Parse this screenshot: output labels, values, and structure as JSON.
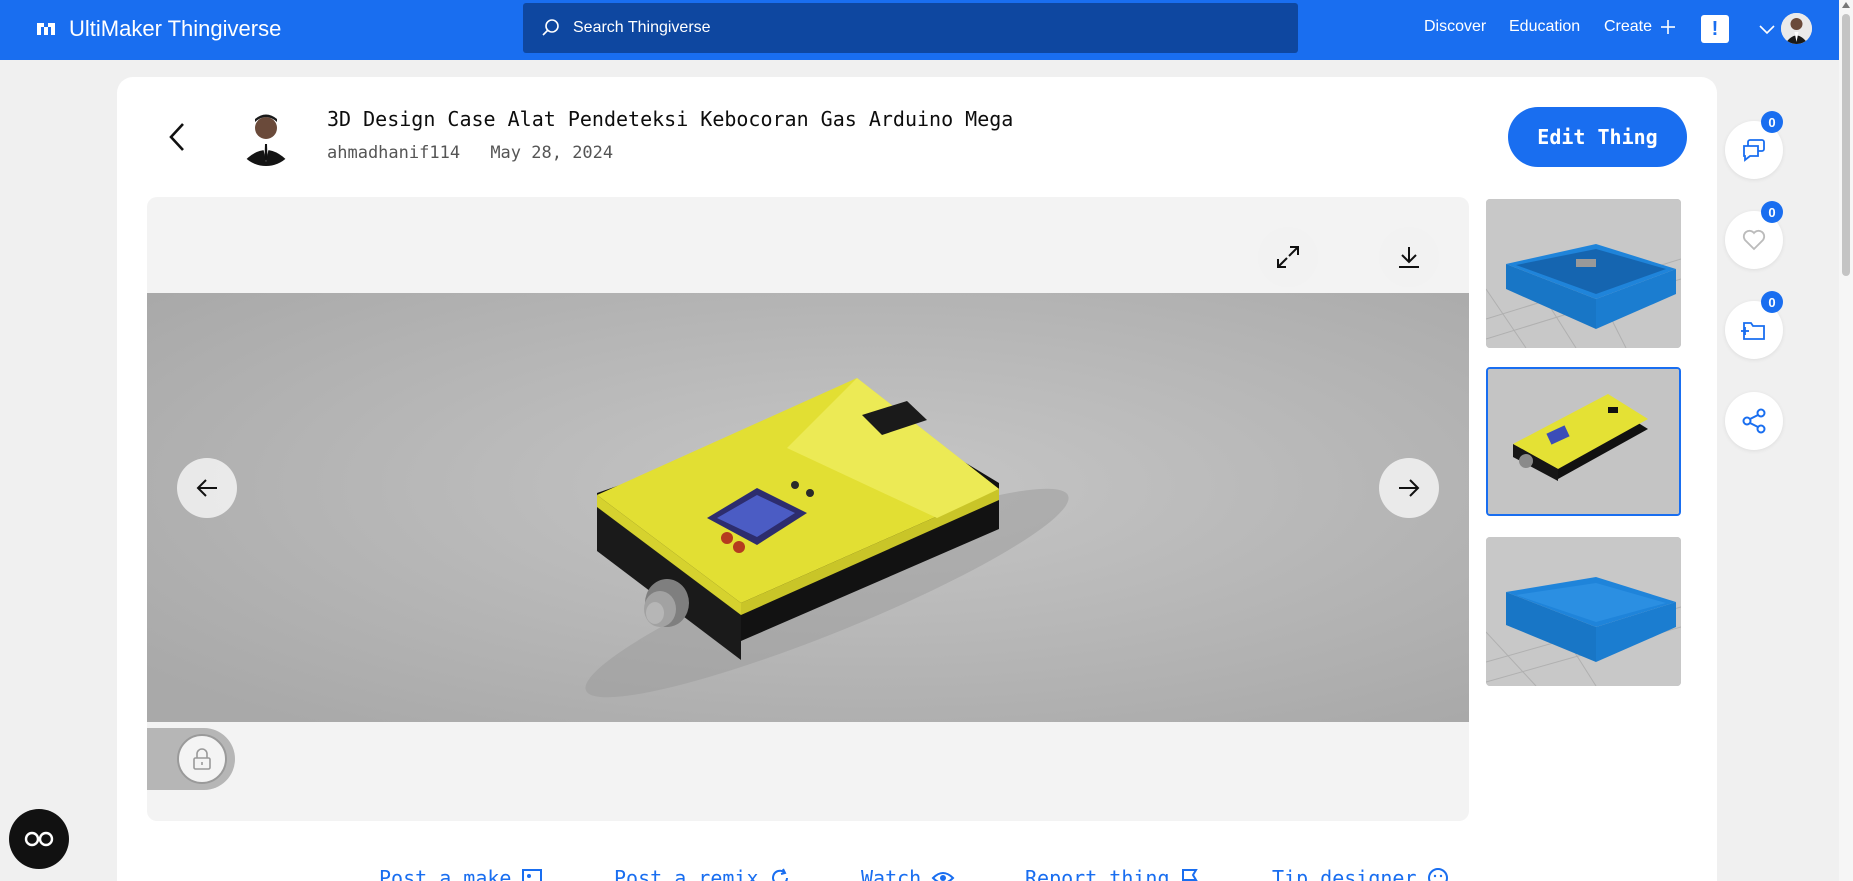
{
  "nav": {
    "brand": "UltiMaker Thingiverse",
    "search_placeholder": "Search Thingiverse",
    "links": [
      "Discover",
      "Education",
      "Create"
    ],
    "alert": "!"
  },
  "thing": {
    "title": "3D Design Case Alat Pendeteksi Kebocoran Gas Arduino Mega",
    "author": "ahmadhanif114",
    "date": "May 28, 2024",
    "edit_label": "Edit Thing"
  },
  "side": {
    "comments": "0",
    "likes": "0",
    "collections": "0"
  },
  "actions": [
    "Post a make",
    "Post a remix",
    "Watch",
    "Report thing",
    "Tip designer"
  ],
  "colors": {
    "brand_blue": "#196ef0",
    "search_bg": "#0e47a0",
    "model_yellow": "#e7e43a",
    "thumb_blue": "#1e7fd6"
  }
}
